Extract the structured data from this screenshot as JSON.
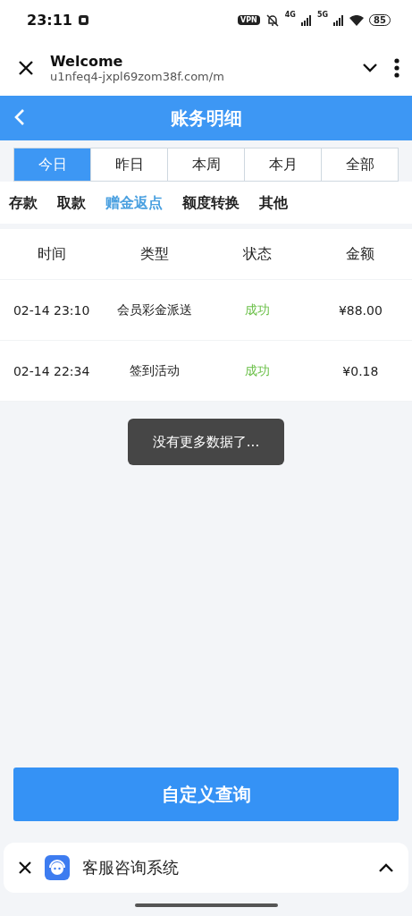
{
  "status_bar": {
    "time": "23:11",
    "vpn": "VPN",
    "net_1": "4G",
    "net_2": "5G",
    "battery": "85"
  },
  "browser_bar": {
    "title": "Welcome",
    "url": "u1nfeq4-jxpl69zom38f.com/m"
  },
  "header": {
    "title": "账务明细"
  },
  "period_tabs": [
    {
      "label": "今日",
      "selected": true
    },
    {
      "label": "昨日",
      "selected": false
    },
    {
      "label": "本周",
      "selected": false
    },
    {
      "label": "本月",
      "selected": false
    },
    {
      "label": "全部",
      "selected": false
    }
  ],
  "category_tabs": [
    {
      "label": "存款",
      "selected": false
    },
    {
      "label": "取款",
      "selected": false
    },
    {
      "label": "赠金返点",
      "selected": true
    },
    {
      "label": "额度转换",
      "selected": false
    },
    {
      "label": "其他",
      "selected": false
    }
  ],
  "table": {
    "columns": [
      "时间",
      "类型",
      "状态",
      "金额"
    ],
    "rows": [
      {
        "time": "02-14 23:10",
        "type": "会员彩金派送",
        "status": "成功",
        "kind": "success",
        "amount": "¥88.00"
      },
      {
        "time": "02-14 22:34",
        "type": "签到活动",
        "status": "成功",
        "kind": "success",
        "amount": "¥0.18"
      }
    ]
  },
  "toast": "没有更多数据了...",
  "query_button": "自定义查询",
  "bottom_sheet": {
    "title": "客服咨询系统"
  }
}
